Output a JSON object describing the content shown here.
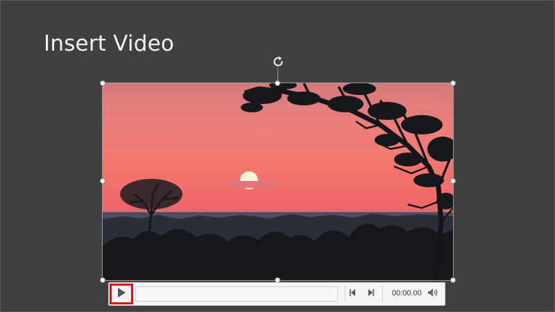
{
  "slide": {
    "title": "Insert Video",
    "background_color": "#404040"
  },
  "video": {
    "poster_description_icon": "sunset-video-frame-icon"
  },
  "controls": {
    "play_icon": "play-icon",
    "back_icon": "skip-back-icon",
    "forward_icon": "skip-forward-icon",
    "time": "00:00.00",
    "volume_icon": "volume-icon",
    "progress": 0,
    "highlight_color": "#e01010"
  }
}
